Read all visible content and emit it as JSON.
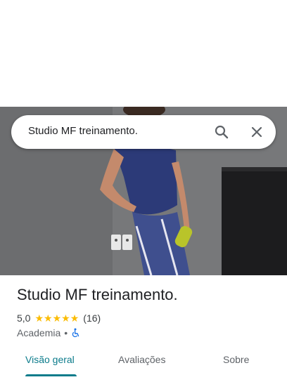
{
  "search": {
    "query": "Studio MF treinamento."
  },
  "place": {
    "name": "Studio MF treinamento.",
    "rating": "5,0",
    "review_count": "(16)",
    "stars": 5,
    "category": "Academia",
    "separator": "•",
    "accessibility_icon": "wheelchair-icon"
  },
  "tabs": [
    {
      "label": "Visão geral",
      "active": true
    },
    {
      "label": "Avaliações",
      "active": false
    },
    {
      "label": "Sobre",
      "active": false
    }
  ],
  "colors": {
    "accent": "#0b7b8b",
    "star": "#fbbc04",
    "accessibility": "#1a73e8"
  }
}
